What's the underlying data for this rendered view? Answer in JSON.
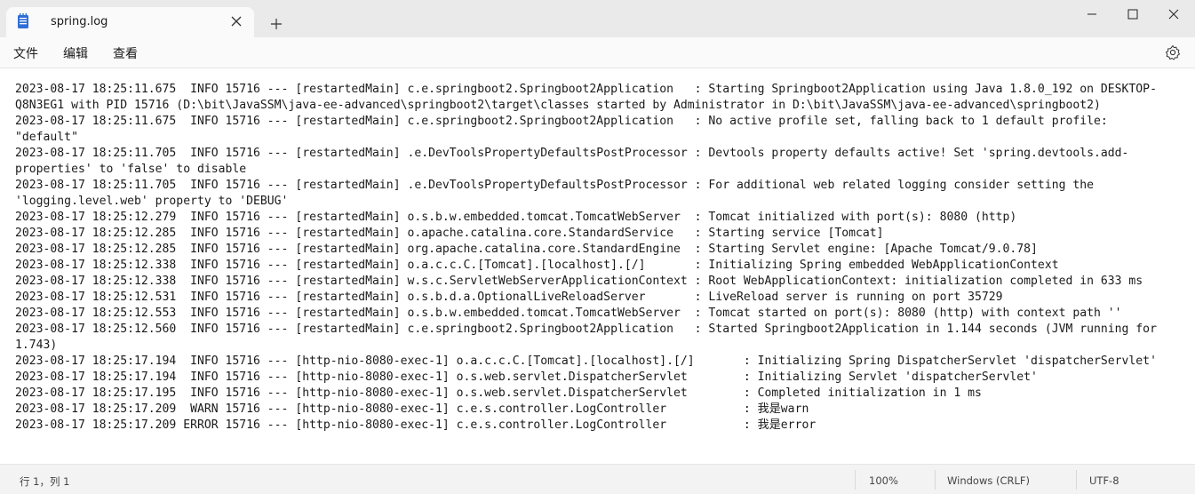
{
  "tab": {
    "title": "spring.log"
  },
  "menu": {
    "file": "文件",
    "edit": "编辑",
    "view": "查看"
  },
  "log_lines": [
    "2023-08-17 18:25:11.675  INFO 15716 --- [restartedMain] c.e.springboot2.Springboot2Application   : Starting Springboot2Application using Java 1.8.0_192 on DESKTOP-",
    "Q8N3EG1 with PID 15716 (D:\\bit\\JavaSSM\\java-ee-advanced\\springboot2\\target\\classes started by Administrator in D:\\bit\\JavaSSM\\java-ee-advanced\\springboot2)",
    "2023-08-17 18:25:11.675  INFO 15716 --- [restartedMain] c.e.springboot2.Springboot2Application   : No active profile set, falling back to 1 default profile:",
    "\"default\"",
    "2023-08-17 18:25:11.705  INFO 15716 --- [restartedMain] .e.DevToolsPropertyDefaultsPostProcessor : Devtools property defaults active! Set 'spring.devtools.add-",
    "properties' to 'false' to disable",
    "2023-08-17 18:25:11.705  INFO 15716 --- [restartedMain] .e.DevToolsPropertyDefaultsPostProcessor : For additional web related logging consider setting the",
    "'logging.level.web' property to 'DEBUG'",
    "2023-08-17 18:25:12.279  INFO 15716 --- [restartedMain] o.s.b.w.embedded.tomcat.TomcatWebServer  : Tomcat initialized with port(s): 8080 (http)",
    "2023-08-17 18:25:12.285  INFO 15716 --- [restartedMain] o.apache.catalina.core.StandardService   : Starting service [Tomcat]",
    "2023-08-17 18:25:12.285  INFO 15716 --- [restartedMain] org.apache.catalina.core.StandardEngine  : Starting Servlet engine: [Apache Tomcat/9.0.78]",
    "2023-08-17 18:25:12.338  INFO 15716 --- [restartedMain] o.a.c.c.C.[Tomcat].[localhost].[/]       : Initializing Spring embedded WebApplicationContext",
    "2023-08-17 18:25:12.338  INFO 15716 --- [restartedMain] w.s.c.ServletWebServerApplicationContext : Root WebApplicationContext: initialization completed in 633 ms",
    "2023-08-17 18:25:12.531  INFO 15716 --- [restartedMain] o.s.b.d.a.OptionalLiveReloadServer       : LiveReload server is running on port 35729",
    "2023-08-17 18:25:12.553  INFO 15716 --- [restartedMain] o.s.b.w.embedded.tomcat.TomcatWebServer  : Tomcat started on port(s): 8080 (http) with context path ''",
    "2023-08-17 18:25:12.560  INFO 15716 --- [restartedMain] c.e.springboot2.Springboot2Application   : Started Springboot2Application in 1.144 seconds (JVM running for",
    "1.743)",
    "2023-08-17 18:25:17.194  INFO 15716 --- [http-nio-8080-exec-1] o.a.c.c.C.[Tomcat].[localhost].[/]       : Initializing Spring DispatcherServlet 'dispatcherServlet'",
    "2023-08-17 18:25:17.194  INFO 15716 --- [http-nio-8080-exec-1] o.s.web.servlet.DispatcherServlet        : Initializing Servlet 'dispatcherServlet'",
    "2023-08-17 18:25:17.195  INFO 15716 --- [http-nio-8080-exec-1] o.s.web.servlet.DispatcherServlet        : Completed initialization in 1 ms",
    "2023-08-17 18:25:17.209  WARN 15716 --- [http-nio-8080-exec-1] c.e.s.controller.LogController           : 我是warn",
    "2023-08-17 18:25:17.209 ERROR 15716 --- [http-nio-8080-exec-1] c.e.s.controller.LogController           : 我是error"
  ],
  "status": {
    "position": "行 1，列 1",
    "zoom": "100%",
    "line_ending": "Windows (CRLF)",
    "encoding": "UTF-8"
  },
  "icons": {
    "tab": "notepad-icon",
    "close": "close-icon",
    "new_tab": "plus-icon",
    "minimize": "minimize-icon",
    "maximize": "maximize-icon",
    "window_close": "window-close-icon",
    "settings": "gear-icon"
  },
  "colors": {
    "accent": "#1f5fbf"
  }
}
